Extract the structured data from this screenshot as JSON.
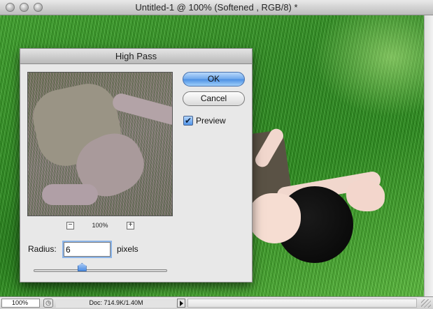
{
  "window": {
    "title": "Untitled-1 @ 100% (Softened , RGB/8) *"
  },
  "status": {
    "zoom": "100%",
    "doc_info": "Doc: 714.9K/1.40M"
  },
  "dialog": {
    "title": "High Pass",
    "preview_zoom": "100%",
    "zoom_out_symbol": "−",
    "zoom_in_symbol": "+",
    "radius_label": "Radius:",
    "radius_value": "6",
    "radius_units": "pixels",
    "radius_slider_level": 0.36,
    "ok_label": "OK",
    "cancel_label": "Cancel",
    "preview_checkbox": {
      "label": "Preview",
      "checked": true,
      "check_glyph": "✔"
    }
  },
  "icons": {
    "close": "close-icon",
    "minimize": "minimize-icon",
    "zoom": "zoom-icon",
    "status_menu": "status-menu-icon"
  }
}
